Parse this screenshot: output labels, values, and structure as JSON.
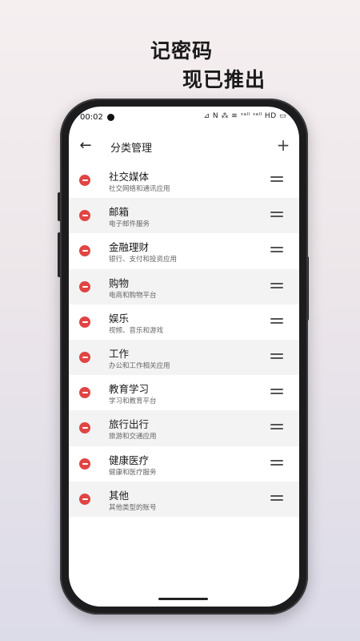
{
  "promo": {
    "line1": "记密码",
    "line2": "现已推出"
  },
  "status_bar": {
    "time": "00:02",
    "icons_text": "⊿ N ⁂ ≋ ᵌᵃˡˡ ᵌᵃˡˡ HD ▭"
  },
  "appbar": {
    "title": "分类管理",
    "back_icon": "arrow-left-icon",
    "add_icon": "plus-icon"
  },
  "categories": [
    {
      "title": "社交媒体",
      "subtitle": "社交网络和通讯应用"
    },
    {
      "title": "邮箱",
      "subtitle": "电子邮件服务"
    },
    {
      "title": "金融理财",
      "subtitle": "银行、支付和投资应用"
    },
    {
      "title": "购物",
      "subtitle": "电商和购物平台"
    },
    {
      "title": "娱乐",
      "subtitle": "视频、音乐和游戏"
    },
    {
      "title": "工作",
      "subtitle": "办公和工作相关应用"
    },
    {
      "title": "教育学习",
      "subtitle": "学习和教育平台"
    },
    {
      "title": "旅行出行",
      "subtitle": "旅游和交通应用"
    },
    {
      "title": "健康医疗",
      "subtitle": "健康和医疗服务"
    },
    {
      "title": "其他",
      "subtitle": "其他类型的账号"
    }
  ],
  "colors": {
    "remove": "#e04545",
    "row_alt": "#f3f3f3",
    "phone_frame": "#1c1c1e"
  }
}
